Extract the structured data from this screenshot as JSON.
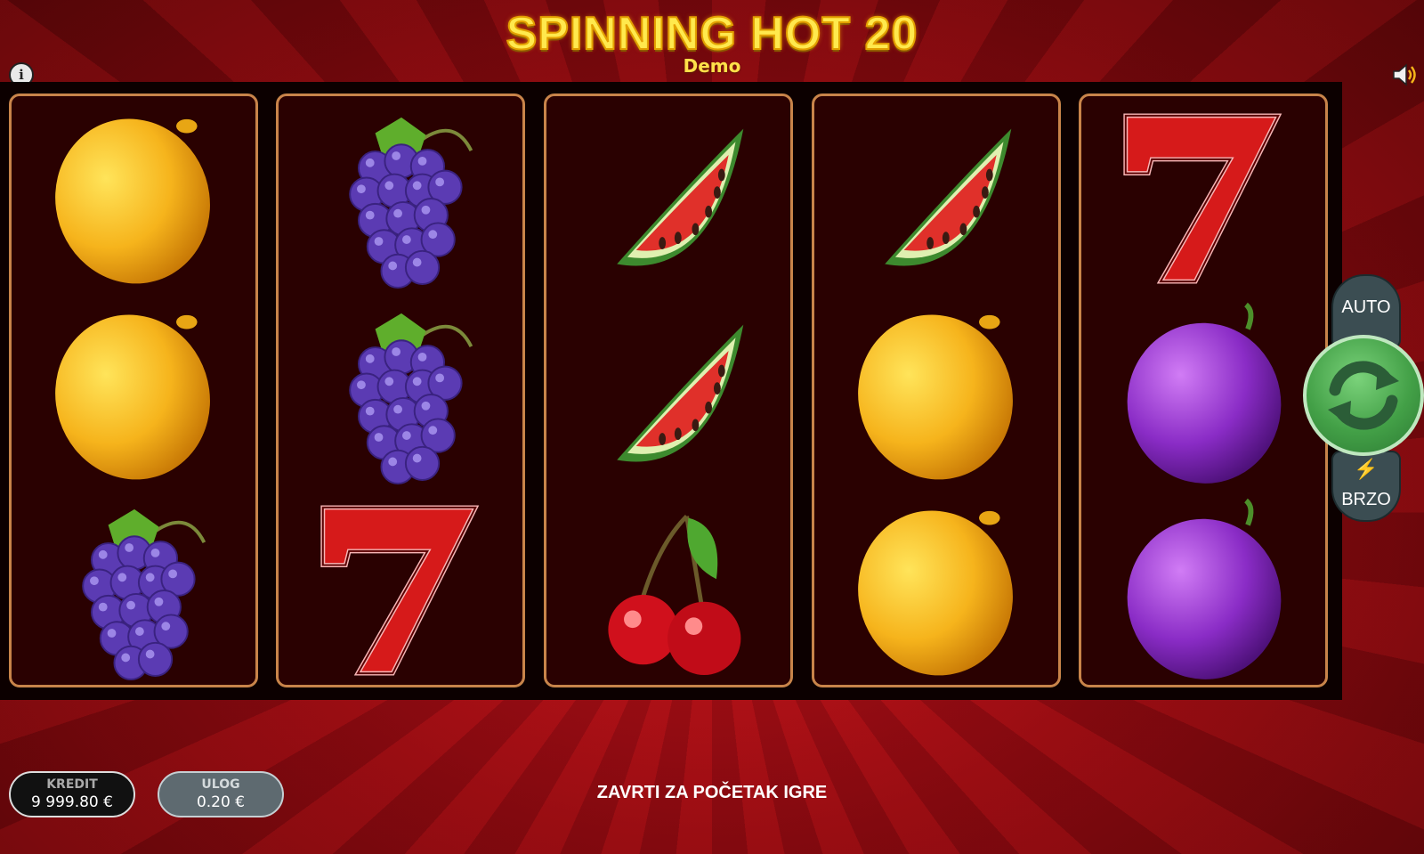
{
  "header": {
    "title": "SPINNING HOT 20",
    "subtitle": "Demo"
  },
  "reels": [
    [
      "lemon",
      "lemon",
      "grapes"
    ],
    [
      "grapes",
      "grapes",
      "seven"
    ],
    [
      "watermelon",
      "watermelon",
      "cherries"
    ],
    [
      "watermelon",
      "lemon",
      "lemon"
    ],
    [
      "seven",
      "plum",
      "plum"
    ]
  ],
  "controls": {
    "auto_label": "AUTO",
    "turbo_label": "BRZO",
    "spin_icon": "refresh-arrows-icon"
  },
  "meters": {
    "credit": {
      "label": "KREDIT",
      "value": "9 999.80 €"
    },
    "bet": {
      "label": "ULOG",
      "value": "0.20 €"
    }
  },
  "status": {
    "message": "ZAVRTI ZA POČETAK IGRE"
  },
  "colors": {
    "reel_border": "#c8844a",
    "spin_green": "#43a047",
    "title_yellow": "#ffe94d"
  }
}
